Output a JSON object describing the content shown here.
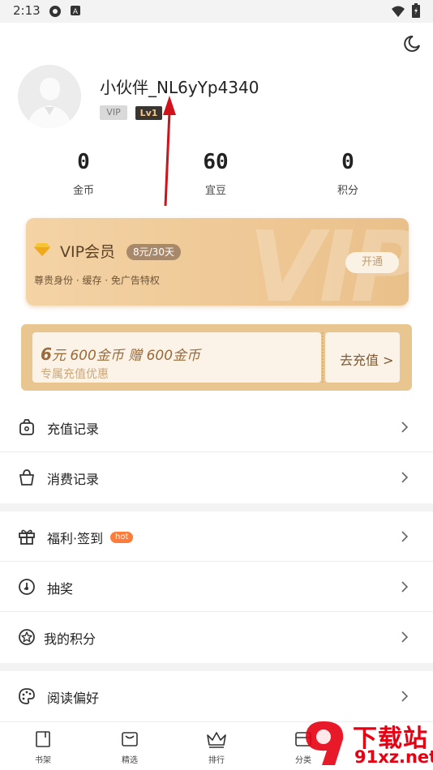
{
  "status_bar": {
    "time": "2:13",
    "icons": [
      "settings-gear-icon",
      "text-a-icon",
      "wifi-icon",
      "battery-icon"
    ]
  },
  "header": {
    "theme_toggle_icon": "moon-icon"
  },
  "profile": {
    "avatar_icon": "default-avatar-icon",
    "username": "小伙伴_NL6yYp4340",
    "badge_vip": "VIP",
    "badge_level": "Lv1"
  },
  "stats": [
    {
      "value": "0",
      "label": "金币"
    },
    {
      "value": "60",
      "label": "宜豆"
    },
    {
      "value": "0",
      "label": "积分"
    }
  ],
  "vip_card": {
    "title": "VIP会员",
    "price": "8元/30天",
    "description": "尊贵身份 · 缓存 · 免广告特权",
    "button": "开通",
    "watermark": "VIP"
  },
  "coupon": {
    "main_prefix": "6",
    "main_text": "元 600金币  赠 600金币",
    "subtitle": "专属充值优惠",
    "action": "去充值 >"
  },
  "menu": {
    "recharge": {
      "label": "充值记录",
      "icon": "wallet-icon"
    },
    "consume": {
      "label": "消费记录",
      "icon": "shopping-bag-icon"
    },
    "welfare": {
      "label": "福利·签到",
      "icon": "gift-icon",
      "badge": "hot"
    },
    "lottery": {
      "label": "抽奖",
      "icon": "lottery-icon"
    },
    "points": {
      "label": "我的积分",
      "icon": "star-badge-icon"
    },
    "preference": {
      "label": "阅读偏好",
      "icon": "palette-icon"
    }
  },
  "tabbar": [
    {
      "label": "书架",
      "icon": "bookshelf-icon"
    },
    {
      "label": "精选",
      "icon": "featured-icon"
    },
    {
      "label": "排行",
      "icon": "crown-icon"
    },
    {
      "label": "分类",
      "icon": "category-icon"
    }
  ],
  "watermark": {
    "line1": "下载站",
    "line2": "91xz.net"
  },
  "colors": {
    "vip_gold": "#eac08a",
    "annotation_arrow": "#d0121b",
    "hot_badge": "#ff7b3a"
  }
}
